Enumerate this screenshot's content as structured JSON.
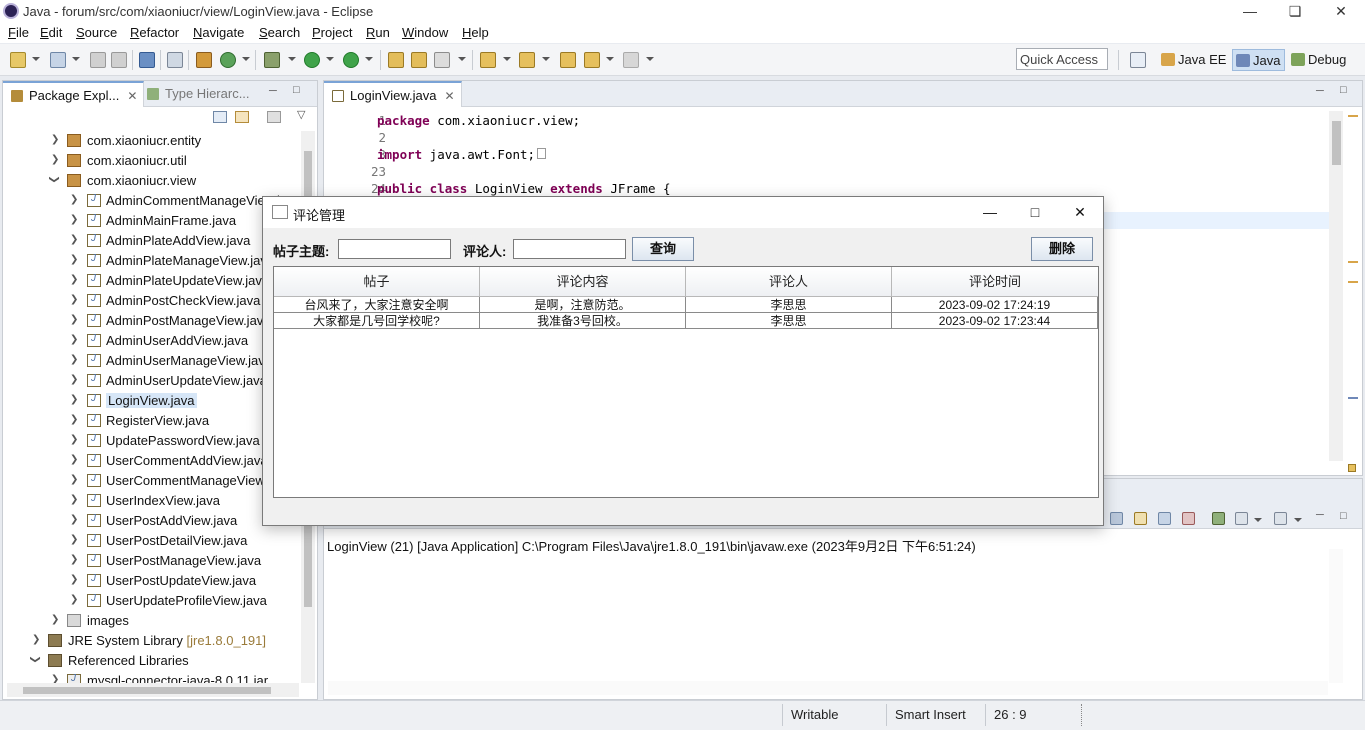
{
  "window": {
    "title": "Java - forum/src/com/xiaoniucr/view/LoginView.java - Eclipse"
  },
  "menu": [
    "File",
    "Edit",
    "Source",
    "Refactor",
    "Navigate",
    "Search",
    "Project",
    "Run",
    "Window",
    "Help"
  ],
  "toolbar": {
    "quick_access": "Quick Access",
    "perspectives": [
      "Java EE",
      "Java",
      "Debug"
    ]
  },
  "package_explorer": {
    "tab_active": "Package Expl...",
    "tab_inactive": "Type Hierarc...",
    "items": [
      "com.xiaoniucr.entity",
      "com.xiaoniucr.util",
      "com.xiaoniucr.view",
      "AdminCommentManageView.java",
      "AdminMainFrame.java",
      "AdminPlateAddView.java",
      "AdminPlateManageView.java",
      "AdminPlateUpdateView.java",
      "AdminPostCheckView.java",
      "AdminPostManageView.java",
      "AdminUserAddView.java",
      "AdminUserManageView.java",
      "AdminUserUpdateView.java",
      "LoginView.java",
      "RegisterView.java",
      "UpdatePasswordView.java",
      "UserCommentAddView.java",
      "UserCommentManageView.java",
      "UserIndexView.java",
      "UserPostAddView.java",
      "UserPostDetailView.java",
      "UserPostManageView.java",
      "UserPostUpdateView.java",
      "UserUpdateProfileView.java",
      "images",
      "JRE System Library",
      "Referenced Libraries",
      "mysql-connector-java-8.0.11.jar"
    ],
    "jre_version": "[jre1.8.0_191]"
  },
  "editor": {
    "tab": "LoginView.java",
    "line_numbers": [
      "1",
      "2",
      "3",
      "23",
      "24"
    ],
    "kw_package": "package",
    "pkg_name": " com.xiaoniucr.view;",
    "kw_import": "import",
    "import_name": " java.awt.Font;",
    "kw_public": "public",
    "kw_class": " class",
    "class_name": " LoginView ",
    "kw_extends": "extends",
    "extends_rest": " JFrame {"
  },
  "console": {
    "line": "LoginView (21) [Java Application] C:\\Program Files\\Java\\jre1.8.0_191\\bin\\javaw.exe (2023年9月2日 下午6:51:24)"
  },
  "statusbar": {
    "writable": "Writable",
    "insert_mode": "Smart Insert",
    "position": "26 : 9"
  },
  "dialog": {
    "title": "评论管理",
    "label_topic": "帖子主题:",
    "label_commenter": "评论人:",
    "btn_query": "查询",
    "btn_delete": "删除",
    "columns": [
      "帖子",
      "评论内容",
      "评论人",
      "评论时间"
    ],
    "rows": [
      [
        "台风来了，大家注意安全啊",
        "是啊，注意防范。",
        "李思思",
        "2023-09-02 17:24:19"
      ],
      [
        "大家都是几号回学校呢?",
        "我准备3号回校。",
        "李思思",
        "2023-09-02 17:23:44"
      ]
    ]
  }
}
